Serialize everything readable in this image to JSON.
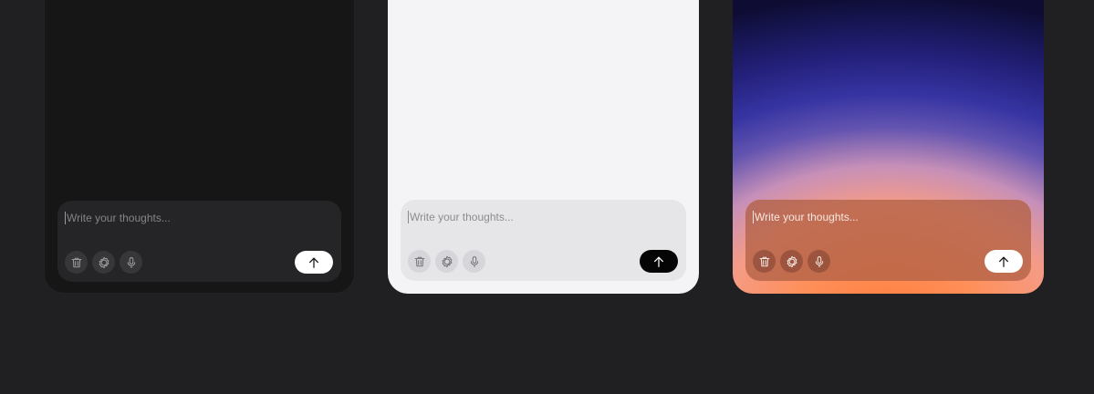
{
  "themes": [
    {
      "name": "dark",
      "composer": {
        "placeholder": "Write your thoughts...",
        "tools": [
          "trash-icon",
          "sparkle-icon",
          "microphone-icon"
        ],
        "send_icon": "arrow-up-icon"
      }
    },
    {
      "name": "light",
      "composer": {
        "placeholder": "Write your thoughts...",
        "tools": [
          "trash-icon",
          "sparkle-icon",
          "microphone-icon"
        ],
        "send_icon": "arrow-up-icon"
      }
    },
    {
      "name": "sunset",
      "composer": {
        "placeholder": "Write your thoughts...",
        "tools": [
          "trash-icon",
          "sparkle-icon",
          "microphone-icon"
        ],
        "send_icon": "arrow-up-icon"
      }
    }
  ],
  "colors": {
    "page_background": "#201f21",
    "dark_surface": "#171617",
    "light_surface": "#f4f3f6",
    "sunset_top": "#0e0c33",
    "sunset_mid": "#3634a2",
    "sunset_bottom": "#ff7c3c",
    "send_dark": "#050505",
    "send_light": "#ffffff"
  }
}
